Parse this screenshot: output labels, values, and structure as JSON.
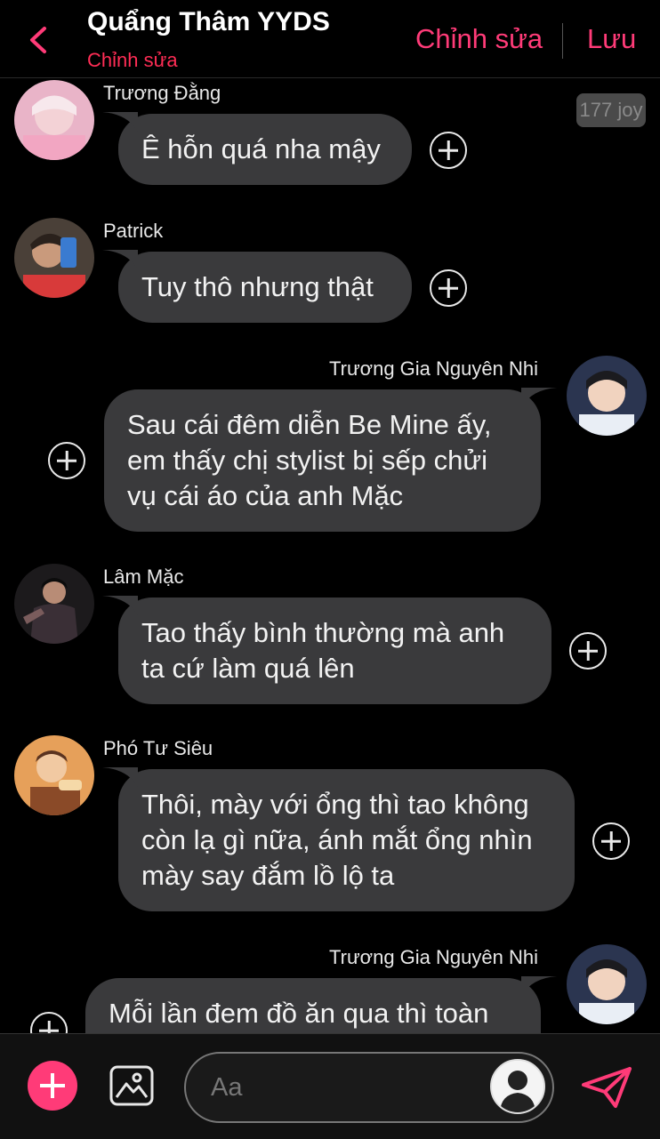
{
  "header": {
    "title": "Quẩng Thâm YYDS",
    "subtitle": "Chỉnh sửa",
    "edit_label": "Chỉnh sửa",
    "save_label": "Lưu"
  },
  "badge": {
    "text": "177 joy"
  },
  "messages": [
    {
      "sender": "Trương Đằng",
      "lines": [
        "Ê hỗn quá nha mậy"
      ],
      "side": "left"
    },
    {
      "sender": "Patrick",
      "lines": [
        "Tuy thô nhưng thật"
      ],
      "side": "left"
    },
    {
      "sender": "Trương Gia Nguyên Nhi",
      "lines": [
        "Sau cái đêm diễn Be Mine ấy,",
        "em thấy chị stylist bị sếp chửi",
        "vụ cái áo của anh Mặc"
      ],
      "side": "right"
    },
    {
      "sender": "Lâm Mặc",
      "lines": [
        "Tao thấy bình thường mà anh",
        "ta cứ làm quá lên"
      ],
      "side": "left"
    },
    {
      "sender": "Phó Tư Siêu",
      "lines": [
        "Thôi, mày với ổng thì tao không",
        "còn lạ gì nữa, ánh mắt ổng nhìn",
        "mày say đắm lồ lộ ta"
      ],
      "side": "left"
    },
    {
      "sender": "Trương Gia Nguyên Nhi",
      "lines": [
        "Mỗi lần đem đồ ăn qua thì toàn"
      ],
      "side": "right"
    }
  ],
  "composer": {
    "placeholder": "Aa"
  },
  "colors": {
    "accent": "#ff3b78",
    "bubble": "#3a3a3c",
    "background": "#000000"
  },
  "icons": {
    "back": "chevron-left-icon",
    "add": "plus-icon",
    "image": "image-icon",
    "send": "send-icon",
    "react": "add-reaction-icon"
  }
}
